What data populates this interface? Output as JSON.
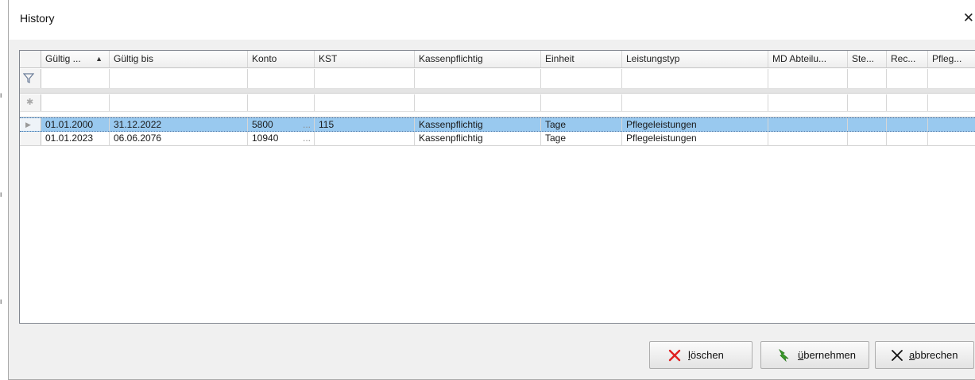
{
  "window": {
    "title": "History",
    "close_glyph": "✕"
  },
  "grid": {
    "columns": [
      {
        "label": "Gültig ...",
        "sort": "ascending"
      },
      {
        "label": "Gültig bis"
      },
      {
        "label": "Konto"
      },
      {
        "label": "KST"
      },
      {
        "label": "Kassenpflichtig"
      },
      {
        "label": "Einheit"
      },
      {
        "label": "Leistungstyp"
      },
      {
        "label": "MD Abteilu..."
      },
      {
        "label": "Ste..."
      },
      {
        "label": "Rec..."
      },
      {
        "label": "Pfleg..."
      }
    ],
    "filter_icon": "filter-icon",
    "new_row_icon": "asterisk-icon",
    "rows": [
      {
        "selected": true,
        "cells": [
          "01.01.2000",
          "31.12.2022",
          "5800",
          "115",
          "Kassenpflichtig",
          "Tage",
          "Pflegeleistungen",
          "",
          "",
          "",
          ""
        ]
      },
      {
        "selected": false,
        "cells": [
          "01.01.2023",
          "06.06.2076",
          "10940",
          "",
          "Kassenpflichtig",
          "Tage",
          "Pflegeleistungen",
          "",
          "",
          "",
          ""
        ]
      }
    ],
    "ellipsis": "...",
    "selected_row_color": "#99c9ef"
  },
  "buttons": {
    "delete": {
      "mnemonic": "l",
      "rest": "öschen",
      "icon": "red-x-icon",
      "icon_color": "#e02020"
    },
    "apply": {
      "mnemonic": "ü",
      "rest": "bernehmen",
      "icon": "green-arrow-icon",
      "icon_color": "#3a9a2a"
    },
    "cancel": {
      "mnemonic": "a",
      "rest": "bbrechen",
      "icon": "black-x-icon",
      "icon_color": "#111111"
    }
  }
}
